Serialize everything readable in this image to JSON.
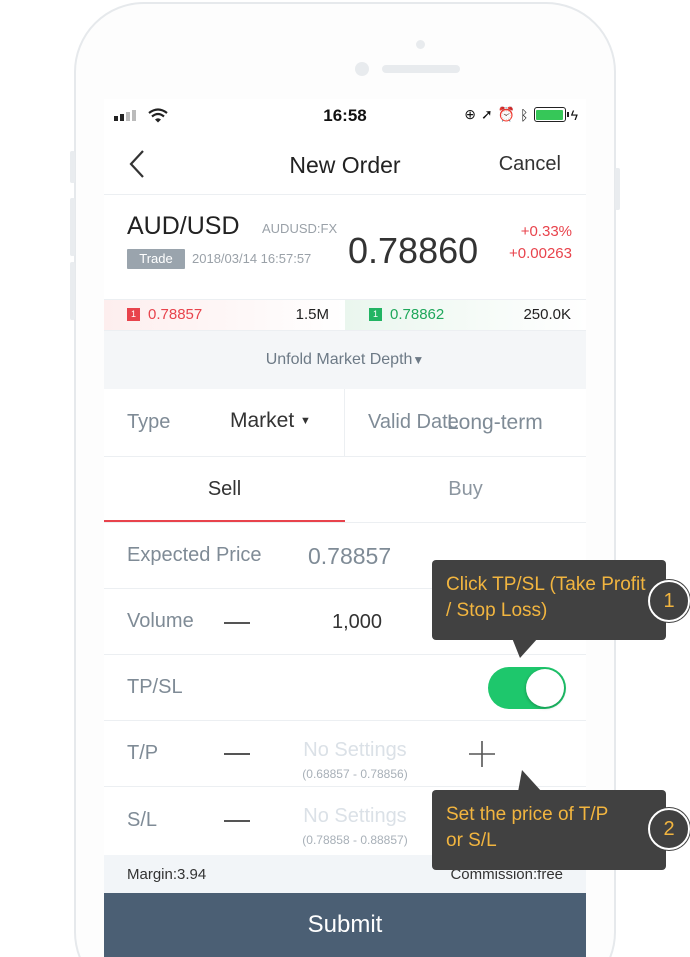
{
  "status": {
    "time": "16:58"
  },
  "nav": {
    "title": "New Order",
    "cancel": "Cancel"
  },
  "quote": {
    "pair": "AUD/USD",
    "code": "AUDUSD:FX",
    "badge": "Trade",
    "timestamp": "2018/03/14 16:57:57",
    "price": "0.78860",
    "change_pct": "+0.33%",
    "change_abs": "+0.00263"
  },
  "depth": {
    "bid_level": "1",
    "bid_price": "0.78857",
    "bid_volume": "1.5M",
    "ask_level": "1",
    "ask_price": "0.78862",
    "ask_volume": "250.0K",
    "unfold": "Unfold Market Depth"
  },
  "order": {
    "type_label": "Type",
    "type_value": "Market",
    "valid_label": "Valid Date",
    "valid_value": "Long-term",
    "tabs": {
      "sell": "Sell",
      "buy": "Buy"
    },
    "expected_label": "Expected Price",
    "expected_value": "0.78857",
    "volume_label": "Volume",
    "volume_value": "1,000",
    "tpsl_label": "TP/SL",
    "tpsl_enabled": true,
    "tp_label": "T/P",
    "tp_placeholder": "No Settings",
    "tp_range": "(0.68857 - 0.78856)",
    "sl_label": "S/L",
    "sl_placeholder": "No Settings",
    "sl_range": "(0.78858 - 0.88857)"
  },
  "footer": {
    "margin": "Margin:3.94",
    "commission": "Commission:free",
    "submit": "Submit"
  },
  "tips": [
    {
      "num": "1",
      "text": "Click TP/SL (Take Profit / Stop Loss)"
    },
    {
      "num": "2",
      "text": "Set the price of T/P or S/L"
    }
  ],
  "colors": {
    "red": "#e8434c",
    "green": "#1ec76c",
    "submit_bg": "#4b5f74",
    "tip_bg": "#414141",
    "tip_text": "#f2b53f"
  }
}
